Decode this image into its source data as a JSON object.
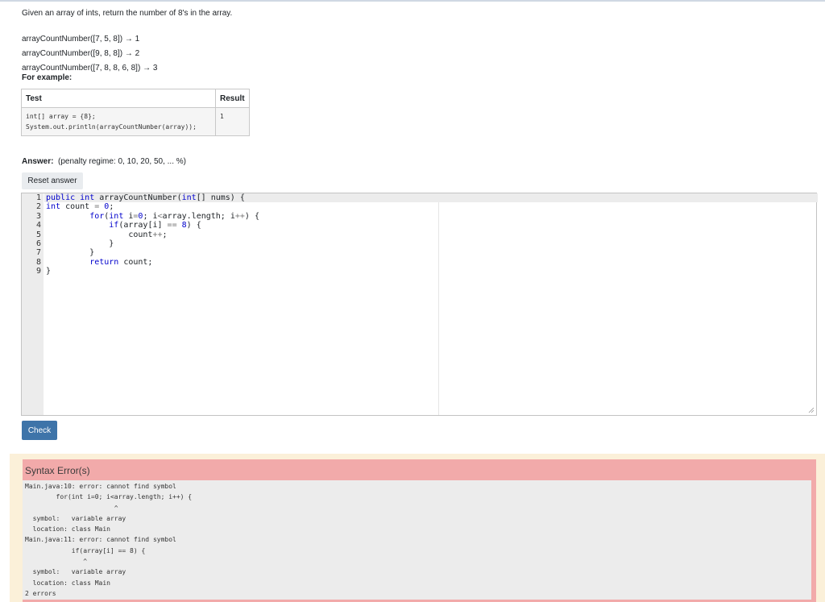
{
  "question": {
    "prompt": "Given an array of ints, return the number of 8's in the array.",
    "examples": [
      "arrayCountNumber([7, 5, 8]) → 1",
      "arrayCountNumber([9, 8, 8]) → 2",
      "arrayCountNumber([7, 8, 8, 6, 8]) → 3"
    ],
    "for_example_label": "For example:"
  },
  "tests_table": {
    "headers": [
      "Test",
      "Result"
    ],
    "row": {
      "test_line1": "int[] array = {8};",
      "test_line2": "System.out.println(arrayCountNumber(array));",
      "result": "1"
    }
  },
  "answer": {
    "label": "Answer:",
    "penalty": "(penalty regime: 0, 10, 20, 50, ... %)",
    "reset_button": "Reset answer"
  },
  "editor": {
    "line_numbers": [
      "1",
      "2",
      "3",
      "4",
      "5",
      "6",
      "7",
      "8",
      "9"
    ]
  },
  "check_button": "Check",
  "feedback": {
    "title": "Syntax Error(s)",
    "output": "Main.java:10: error: cannot find symbol\n        for(int i=0; i<array.length; i++) {\n                       ^\n  symbol:   variable array\n  location: class Main\nMain.java:11: error: cannot find symbol\n            if(array[i] == 8) {\n               ^\n  symbol:   variable array\n  location: class Main\n2 errors"
  },
  "colors": {
    "check_button_bg": "#3e74a9",
    "error_bg": "#f2aaaa",
    "feedback_bg": "#fbf0d9",
    "keyword": "#0000cc"
  }
}
